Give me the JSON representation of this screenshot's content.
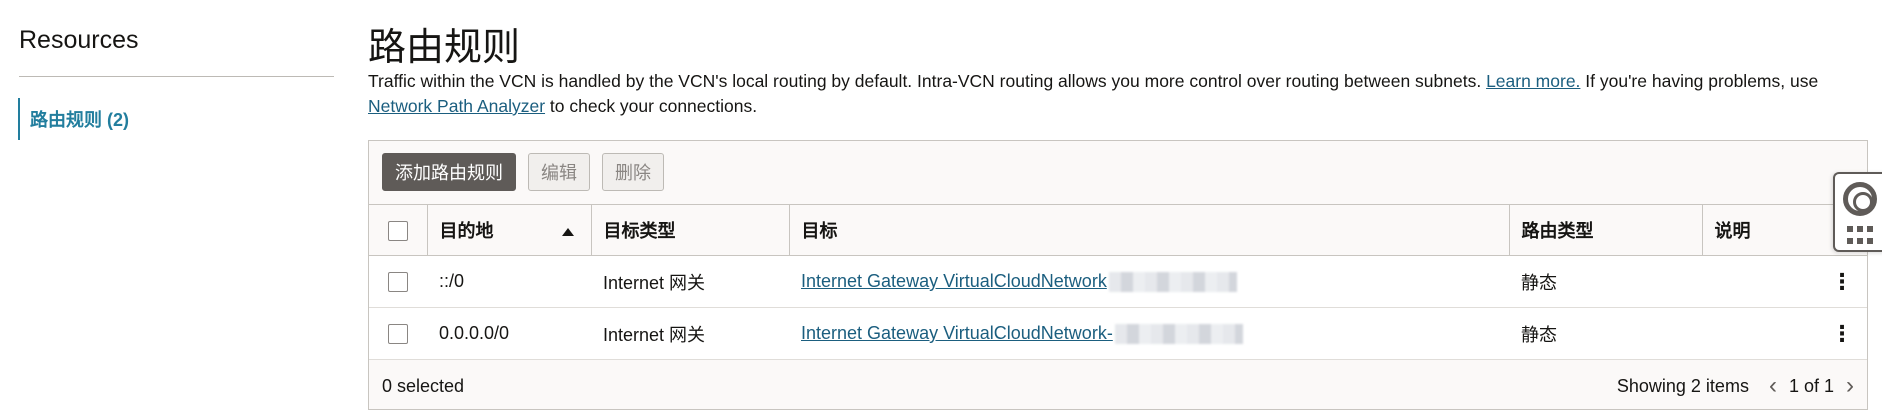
{
  "resources": {
    "title": "Resources",
    "items": [
      {
        "label": "路由规则 (2)"
      }
    ]
  },
  "main": {
    "title": "路由规则",
    "description": {
      "text1": "Traffic within the VCN is handled by the VCN's local routing by default. Intra-VCN routing allows you more control over routing between subnets. ",
      "link1": "Learn more.",
      "text2": " If you're having problems, use ",
      "link2": "Network Path Analyzer",
      "text3": " to check your connections."
    }
  },
  "toolbar": {
    "add_label": "添加路由规则",
    "edit_label": "编辑",
    "delete_label": "删除"
  },
  "table": {
    "columns": [
      "目的地",
      "目标类型",
      "目标",
      "路由类型",
      "说明"
    ],
    "rows": [
      {
        "destination": "::/0",
        "target_type": "Internet 网关",
        "target": "Internet Gateway VirtualCloudNetwork",
        "route_type": "静态",
        "description": ""
      },
      {
        "destination": "0.0.0.0/0",
        "target_type": "Internet 网关",
        "target": "Internet Gateway VirtualCloudNetwork-",
        "route_type": "静态",
        "description": ""
      }
    ]
  },
  "footer": {
    "selected": "0 selected",
    "showing": "Showing 2 items",
    "page": "1 of 1"
  },
  "colors": {
    "accent": "#227e9e",
    "link": "#1b5e7f",
    "primary_button": "#5f5b58"
  },
  "icons": [
    "sort-ascending-icon",
    "kebab-menu-icon",
    "chevron-left-icon",
    "chevron-right-icon",
    "lifebuoy-icon",
    "apps-grid-icon"
  ]
}
